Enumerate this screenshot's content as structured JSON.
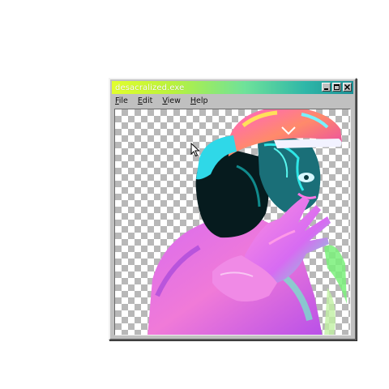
{
  "window": {
    "title": "desacralized.exe",
    "controls": [
      "minimize",
      "maximize",
      "close"
    ]
  },
  "menubar": {
    "items": [
      {
        "first": "F",
        "rest": "ile"
      },
      {
        "first": "E",
        "rest": "dit"
      },
      {
        "first": "V",
        "rest": "iew"
      },
      {
        "first": "H",
        "rest": "elp"
      }
    ]
  },
  "canvas": {
    "background": "transparency-checkerboard",
    "image": "neon-portrait-person-in-cap",
    "cursor_icon": "arrow-cursor-icon"
  },
  "colors": {
    "titlebar_start": "#e2ff2c",
    "titlebar_end": "#1b8f95",
    "frame": "#c0c0c0",
    "checker": "#b8b8b8"
  }
}
